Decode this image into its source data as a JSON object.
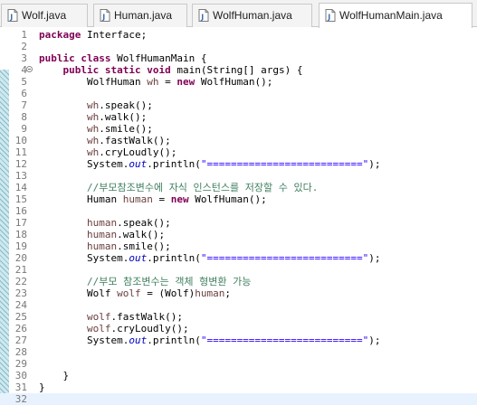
{
  "editor_tabs": [
    {
      "label": "Wolf.java",
      "active": false,
      "icon": "java-file-icon"
    },
    {
      "label": "Human.java",
      "active": false,
      "icon": "java-file-icon"
    },
    {
      "label": "WolfHuman.java",
      "active": false,
      "icon": "java-file-icon"
    },
    {
      "label": "WolfHumanMain.java",
      "active": true,
      "icon": "java-file-icon"
    }
  ],
  "syntax_colors": {
    "keyword": "#7f0055",
    "comment": "#3f7f5f",
    "string": "#2a00ff",
    "static_field": "#0000c0",
    "local_variable": "#6a3e3e",
    "current_line_bg": "#e8f2fe"
  },
  "code_lines": [
    {
      "n": "1",
      "tokens": [
        [
          "kw",
          "package"
        ],
        [
          "pl",
          " Interface;"
        ]
      ]
    },
    {
      "n": "2",
      "tokens": []
    },
    {
      "n": "3",
      "tokens": [
        [
          "kw",
          "public"
        ],
        [
          "pl",
          " "
        ],
        [
          "kw",
          "class"
        ],
        [
          "pl",
          " WolfHumanMain {"
        ]
      ]
    },
    {
      "n": "4",
      "fold": true,
      "tokens": [
        [
          "pl",
          "    "
        ],
        [
          "kw",
          "public"
        ],
        [
          "pl",
          " "
        ],
        [
          "kw",
          "static"
        ],
        [
          "pl",
          " "
        ],
        [
          "kw",
          "void"
        ],
        [
          "pl",
          " main(String[] args) {"
        ]
      ]
    },
    {
      "n": "5",
      "tokens": [
        [
          "pl",
          "        WolfHuman "
        ],
        [
          "var",
          "wh"
        ],
        [
          "pl",
          " = "
        ],
        [
          "kw",
          "new"
        ],
        [
          "pl",
          " WolfHuman();"
        ]
      ]
    },
    {
      "n": "6",
      "tokens": []
    },
    {
      "n": "7",
      "tokens": [
        [
          "pl",
          "        "
        ],
        [
          "var",
          "wh"
        ],
        [
          "pl",
          ".speak();"
        ]
      ]
    },
    {
      "n": "8",
      "tokens": [
        [
          "pl",
          "        "
        ],
        [
          "var",
          "wh"
        ],
        [
          "pl",
          ".walk();"
        ]
      ]
    },
    {
      "n": "9",
      "tokens": [
        [
          "pl",
          "        "
        ],
        [
          "var",
          "wh"
        ],
        [
          "pl",
          ".smile();"
        ]
      ]
    },
    {
      "n": "10",
      "tokens": [
        [
          "pl",
          "        "
        ],
        [
          "var",
          "wh"
        ],
        [
          "pl",
          ".fastWalk();"
        ]
      ]
    },
    {
      "n": "11",
      "tokens": [
        [
          "pl",
          "        "
        ],
        [
          "var",
          "wh"
        ],
        [
          "pl",
          ".cryLoudly();"
        ]
      ]
    },
    {
      "n": "12",
      "tokens": [
        [
          "pl",
          "        System."
        ],
        [
          "fld",
          "out"
        ],
        [
          "pl",
          ".println("
        ],
        [
          "str",
          "\"==========================\""
        ],
        [
          "pl",
          ");"
        ]
      ]
    },
    {
      "n": "13",
      "tokens": []
    },
    {
      "n": "14",
      "tokens": [
        [
          "pl",
          "        "
        ],
        [
          "cmt",
          "//부모참조변수에 자식 인스턴스를 저장할 수 있다."
        ]
      ]
    },
    {
      "n": "15",
      "tokens": [
        [
          "pl",
          "        Human "
        ],
        [
          "var",
          "human"
        ],
        [
          "pl",
          " = "
        ],
        [
          "kw",
          "new"
        ],
        [
          "pl",
          " WolfHuman();"
        ]
      ]
    },
    {
      "n": "16",
      "tokens": []
    },
    {
      "n": "17",
      "tokens": [
        [
          "pl",
          "        "
        ],
        [
          "var",
          "human"
        ],
        [
          "pl",
          ".speak();"
        ]
      ]
    },
    {
      "n": "18",
      "tokens": [
        [
          "pl",
          "        "
        ],
        [
          "var",
          "human"
        ],
        [
          "pl",
          ".walk();"
        ]
      ]
    },
    {
      "n": "19",
      "tokens": [
        [
          "pl",
          "        "
        ],
        [
          "var",
          "human"
        ],
        [
          "pl",
          ".smile();"
        ]
      ]
    },
    {
      "n": "20",
      "tokens": [
        [
          "pl",
          "        System."
        ],
        [
          "fld",
          "out"
        ],
        [
          "pl",
          ".println("
        ],
        [
          "str",
          "\"==========================\""
        ],
        [
          "pl",
          ");"
        ]
      ]
    },
    {
      "n": "21",
      "tokens": []
    },
    {
      "n": "22",
      "tokens": [
        [
          "pl",
          "        "
        ],
        [
          "cmt",
          "//부모 참조변수는 객체 형변환 가능"
        ]
      ]
    },
    {
      "n": "23",
      "tokens": [
        [
          "pl",
          "        Wolf "
        ],
        [
          "var",
          "wolf"
        ],
        [
          "pl",
          " = (Wolf)"
        ],
        [
          "var",
          "human"
        ],
        [
          "pl",
          ";"
        ]
      ]
    },
    {
      "n": "24",
      "tokens": []
    },
    {
      "n": "25",
      "tokens": [
        [
          "pl",
          "        "
        ],
        [
          "var",
          "wolf"
        ],
        [
          "pl",
          ".fastWalk();"
        ]
      ]
    },
    {
      "n": "26",
      "tokens": [
        [
          "pl",
          "        "
        ],
        [
          "var",
          "wolf"
        ],
        [
          "pl",
          ".cryLoudly();"
        ]
      ]
    },
    {
      "n": "27",
      "tokens": [
        [
          "pl",
          "        System."
        ],
        [
          "fld",
          "out"
        ],
        [
          "pl",
          ".println("
        ],
        [
          "str",
          "\"==========================\""
        ],
        [
          "pl",
          ");"
        ]
      ]
    },
    {
      "n": "28",
      "tokens": []
    },
    {
      "n": "29",
      "tokens": []
    },
    {
      "n": "30",
      "tokens": [
        [
          "pl",
          "    }"
        ]
      ]
    },
    {
      "n": "31",
      "tokens": [
        [
          "pl",
          "}"
        ]
      ]
    },
    {
      "n": "32",
      "current": true,
      "tokens": []
    }
  ]
}
